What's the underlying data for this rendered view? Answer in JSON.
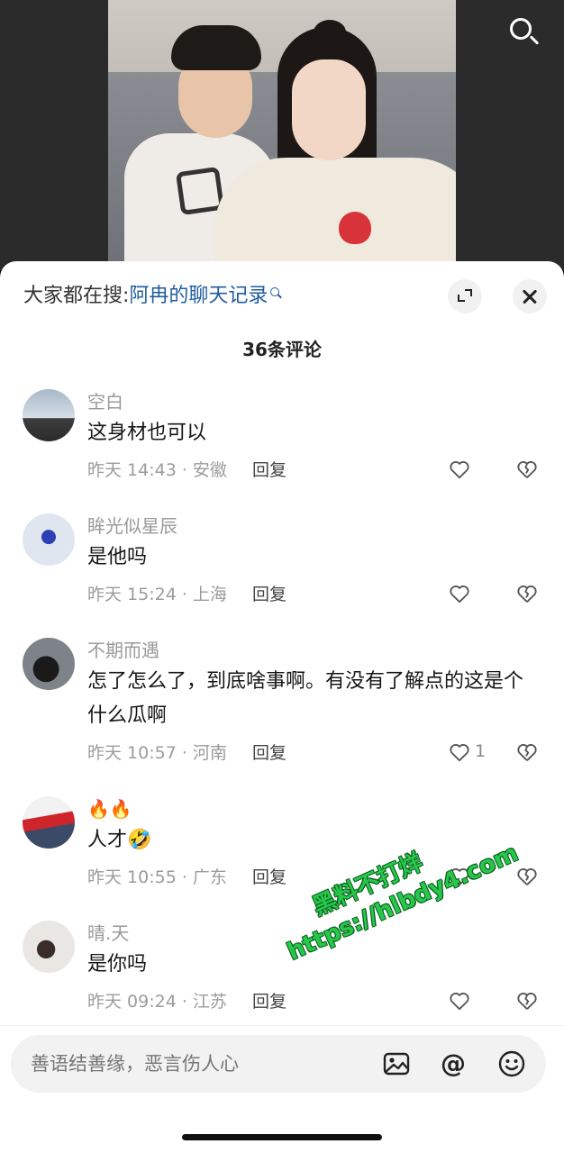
{
  "video": {
    "search_icon": "search-icon"
  },
  "sheet": {
    "trend_prefix": "大家都在搜:",
    "trend_link": "阿冉的聊天记录",
    "comment_count": "36条评论",
    "reply_label": "回复"
  },
  "comments": [
    {
      "name": "空白",
      "text": "这身材也可以",
      "meta": "昨天 14:43 · 安徽",
      "likes": ""
    },
    {
      "name": "眸光似星辰",
      "text": "是他吗",
      "meta": "昨天 15:24 · 上海",
      "likes": ""
    },
    {
      "name": "不期而遇",
      "text": "怎了怎么了，到底啥事啊。有没有了解点的这是个什么瓜啊",
      "meta": "昨天 10:57 · 河南",
      "likes": "1"
    },
    {
      "name": "🔥🔥",
      "text": "人才🤣",
      "meta": "昨天 10:55 · 广东",
      "likes": ""
    },
    {
      "name": "晴.天",
      "text": "是你吗",
      "meta": "昨天 09:24 · 江苏",
      "likes": ""
    }
  ],
  "input": {
    "placeholder": "善语结善缘，恶言伤人心",
    "at_symbol": "@"
  },
  "watermark": {
    "line1": "黑料不打烊",
    "line2": "https://hlbdy4.com"
  },
  "colors": {
    "link": "#1f5c9e",
    "watermark": "#27c84a"
  }
}
